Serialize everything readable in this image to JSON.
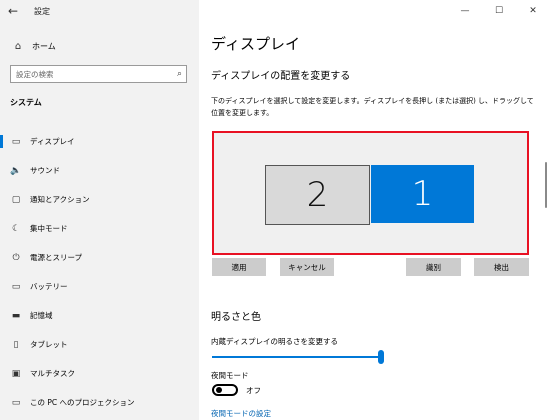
{
  "window": {
    "title": "設定",
    "back_glyph": "←",
    "minimize_glyph": "—",
    "maximize_glyph": "☐",
    "close_glyph": "✕"
  },
  "sidebar": {
    "home_label": "ホーム",
    "search_placeholder": "設定の検索",
    "section_title": "システム",
    "items": [
      {
        "label": "ディスプレイ",
        "icon": "monitor-icon",
        "glyph": "▭",
        "active": true
      },
      {
        "label": "サウンド",
        "icon": "speaker-icon",
        "glyph": "🔈",
        "active": false
      },
      {
        "label": "通知とアクション",
        "icon": "notification-icon",
        "glyph": "▢",
        "active": false
      },
      {
        "label": "集中モード",
        "icon": "moon-icon",
        "glyph": "☾",
        "active": false
      },
      {
        "label": "電源とスリープ",
        "icon": "power-icon",
        "glyph": "⏻",
        "active": false
      },
      {
        "label": "バッテリー",
        "icon": "battery-icon",
        "glyph": "▭",
        "active": false
      },
      {
        "label": "記憶域",
        "icon": "storage-icon",
        "glyph": "▬",
        "active": false
      },
      {
        "label": "タブレット",
        "icon": "tablet-icon",
        "glyph": "▯",
        "active": false
      },
      {
        "label": "マルチタスク",
        "icon": "multitask-icon",
        "glyph": "▣",
        "active": false
      },
      {
        "label": "この PC へのプロジェクション",
        "icon": "projection-icon",
        "glyph": "▭",
        "active": false
      }
    ]
  },
  "main": {
    "title": "ディスプレイ",
    "arrange_heading": "ディスプレイの配置を変更する",
    "arrange_desc": "下のディスプレイを選択して設定を変更します。ディスプレイを長押し (または選択) し、ドラッグして位置を変更します。",
    "monitors": [
      {
        "number": "2",
        "selected": false
      },
      {
        "number": "1",
        "selected": true
      }
    ],
    "buttons": {
      "apply": "適用",
      "cancel": "キャンセル",
      "identify": "識別",
      "detect": "検出"
    },
    "brightness_heading": "明るさと色",
    "brightness_label": "内蔵ディスプレイの明るさを変更する",
    "brightness_value": 100,
    "night_mode_label": "夜間モード",
    "night_mode_state": "オフ",
    "night_mode_link": "夜間モードの設定"
  },
  "colors": {
    "accent": "#0078d7",
    "selection_border": "#e81123",
    "sidebar_bg": "#f2f2f2"
  }
}
